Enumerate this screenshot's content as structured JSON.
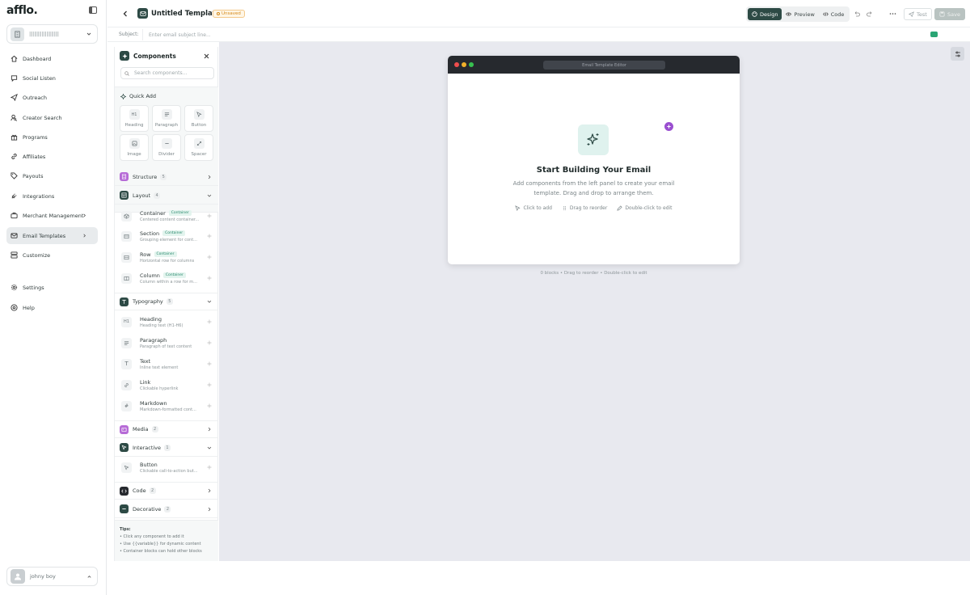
{
  "app": {
    "logo": "afflo.",
    "workspace_name": "||||||||||||||||||||||||"
  },
  "sidebar": {
    "items": [
      {
        "label": "Dashboard",
        "icon": "home-icon"
      },
      {
        "label": "Social Listen",
        "icon": "chat-icon"
      },
      {
        "label": "Outreach",
        "icon": "send-icon"
      },
      {
        "label": "Creator Search",
        "icon": "user-search-icon"
      },
      {
        "label": "Programs",
        "icon": "gift-icon"
      },
      {
        "label": "Affiliates",
        "icon": "link-icon"
      },
      {
        "label": "Payouts",
        "icon": "tag-icon"
      },
      {
        "label": "Integrations",
        "icon": "plug-icon"
      },
      {
        "label": "Merchant Management",
        "icon": "briefcase-icon"
      },
      {
        "label": "Email Templates",
        "icon": "mail-icon"
      },
      {
        "label": "Customize",
        "icon": "layout-icon"
      },
      {
        "label": "Settings",
        "icon": "gear-icon"
      },
      {
        "label": "Help",
        "icon": "help-icon"
      }
    ],
    "user": "johny boy"
  },
  "header": {
    "title": "Untitled Template",
    "status": "Unsaved",
    "views": [
      "Design",
      "Preview",
      "Code"
    ],
    "active_view": "Design",
    "test_label": "Test",
    "save_label": "Save"
  },
  "subject": {
    "label": "Subject:",
    "placeholder": "Enter email subject line..."
  },
  "components": {
    "title": "Components",
    "search_placeholder": "Search components...",
    "quick_add": {
      "title": "Quick Add",
      "items": [
        {
          "label": "Heading",
          "glyph": "H1"
        },
        {
          "label": "Paragraph",
          "glyph": ""
        },
        {
          "label": "Button",
          "glyph": ""
        },
        {
          "label": "Image",
          "glyph": ""
        },
        {
          "label": "Divider",
          "glyph": ""
        },
        {
          "label": "Spacer",
          "glyph": ""
        }
      ]
    },
    "categories": {
      "structure": {
        "name": "Structure",
        "count": "5",
        "color": "#b66bd6"
      },
      "layout": {
        "name": "Layout",
        "count": "4",
        "color": "#2d4a45"
      },
      "typography": {
        "name": "Typography",
        "count": "5",
        "color": "#2d4a45"
      },
      "media": {
        "name": "Media",
        "count": "2",
        "color": "#b66bd6"
      },
      "interactive": {
        "name": "Interactive",
        "count": "1",
        "color": "#2d4a45"
      },
      "code": {
        "name": "Code",
        "count": "2",
        "color": "#26292e"
      },
      "decorative": {
        "name": "Decorative",
        "count": "2",
        "color": "#2d4a45"
      }
    },
    "layout_items": [
      {
        "name": "Container",
        "tag": "Container",
        "desc": "Centered content container..."
      },
      {
        "name": "Section",
        "tag": "Container",
        "desc": "Grouping element for cont..."
      },
      {
        "name": "Row",
        "tag": "Container",
        "desc": "Horizontal row for columns"
      },
      {
        "name": "Column",
        "tag": "Container",
        "desc": "Column within a row for m..."
      }
    ],
    "typography_items": [
      {
        "name": "Heading",
        "desc": "Heading text (H1-H6)",
        "glyph": "H1"
      },
      {
        "name": "Paragraph",
        "desc": "Paragraph of text content",
        "glyph": ""
      },
      {
        "name": "Text",
        "desc": "Inline text element",
        "glyph": "T"
      },
      {
        "name": "Link",
        "desc": "Clickable hyperlink",
        "glyph": ""
      },
      {
        "name": "Markdown",
        "desc": "Markdown-formatted cont...",
        "glyph": "#"
      }
    ],
    "interactive_items": [
      {
        "name": "Button",
        "desc": "Clickable call-to-action but..."
      }
    ],
    "tips": {
      "title": "Tips:",
      "lines": [
        "• Click any component to add it",
        "• Use {{variable}} for dynamic content",
        "• Container blocks can hold other blocks"
      ]
    }
  },
  "canvas": {
    "window_title": "Email Template Editor",
    "heading": "Start Building Your Email",
    "subtext": "Add components from the left panel to create your email template. Drag and drop to arrange them.",
    "hints": [
      "Click to add",
      "Drag to reorder",
      "Double-click to edit"
    ],
    "footer": "0 blocks • Drag to reorder • Double-click to edit"
  }
}
